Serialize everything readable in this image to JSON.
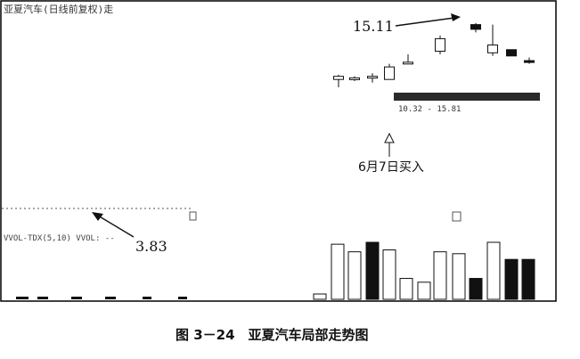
{
  "figure": {
    "panel_title": "亚夏汽车(日线前复权)走",
    "volume_legend": "VVOL-TDX(5,10) VVOL: --",
    "price_range_label": "10.32 - 15.81",
    "caption": "图 3－24　亚夏汽车局部走势图"
  },
  "annotations": {
    "peak_value": "15.11",
    "low_value": "3.83",
    "buy_signal": "6月7日买入"
  },
  "colors": {
    "up_candle": "#ffffff",
    "down_candle": "#111111",
    "volume_up": "#ffffff",
    "volume_down": "#111111",
    "band": "#2a2a2a",
    "frame": "#000000"
  },
  "chart_data": {
    "type": "candlestick",
    "price_axis": {
      "min": 3.5,
      "max": 16.0
    },
    "candles": [
      {
        "open": 11.5,
        "high": 11.8,
        "low": 11.0,
        "close": 11.7
      },
      {
        "open": 11.6,
        "high": 11.7,
        "low": 11.4,
        "close": 11.6
      },
      {
        "open": 11.6,
        "high": 11.9,
        "low": 11.3,
        "close": 11.7
      },
      {
        "open": 11.5,
        "high": 12.5,
        "low": 11.5,
        "close": 12.3
      },
      {
        "open": 12.6,
        "high": 13.1,
        "low": 12.5,
        "close": 12.6
      },
      {
        "open": 13.3,
        "high": 14.3,
        "low": 13.1,
        "close": 14.1
      },
      {
        "open": 15.0,
        "high": 15.1,
        "low": 14.5,
        "close": 14.7
      },
      {
        "open": 13.2,
        "high": 15.0,
        "low": 13.0,
        "close": 13.7
      },
      {
        "open": 13.4,
        "high": 13.4,
        "low": 13.0,
        "close": 13.0
      },
      {
        "open": 12.7,
        "high": 12.9,
        "low": 12.5,
        "close": 12.6
      }
    ],
    "volume": [
      {
        "value": 29,
        "direction": "up"
      },
      {
        "value": 25,
        "direction": "up"
      },
      {
        "value": 30,
        "direction": "down"
      },
      {
        "value": 26,
        "direction": "up"
      },
      {
        "value": 11,
        "direction": "up"
      },
      {
        "value": 9,
        "direction": "up"
      },
      {
        "value": 25,
        "direction": "up"
      },
      {
        "value": 24,
        "direction": "up"
      },
      {
        "value": 11,
        "direction": "down"
      },
      {
        "value": 30,
        "direction": "up"
      },
      {
        "value": 21,
        "direction": "down"
      },
      {
        "value": 21,
        "direction": "down"
      }
    ]
  }
}
